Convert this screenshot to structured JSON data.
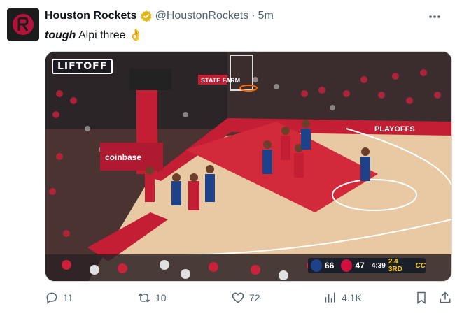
{
  "tweet": {
    "author_name": "Houston Rockets",
    "handle": "@HoustonRockets",
    "separator": "·",
    "time": "5m",
    "text_emphasis": "tough",
    "text_rest": " Alpi three 👌",
    "avatar_icon": "rockets-logo-icon",
    "verified_icon": "verified-badge-icon"
  },
  "media": {
    "liftoff_label": "LIFTOFF",
    "court_banner": "STATE FARM",
    "coinbase_label": "coinbase",
    "playoffs_label": "PLAYOFFS",
    "scorebug": {
      "away_score": "66",
      "home_score": "47",
      "clock": "4:39",
      "quarter": "2.4 3RD",
      "network": "CC"
    }
  },
  "actions": {
    "replies": "11",
    "reposts": "10",
    "likes": "72",
    "views": "4.1K"
  },
  "colors": {
    "accent_red": "#ce1141",
    "text_gray": "#536471",
    "verified_gold": "#e2b719"
  }
}
